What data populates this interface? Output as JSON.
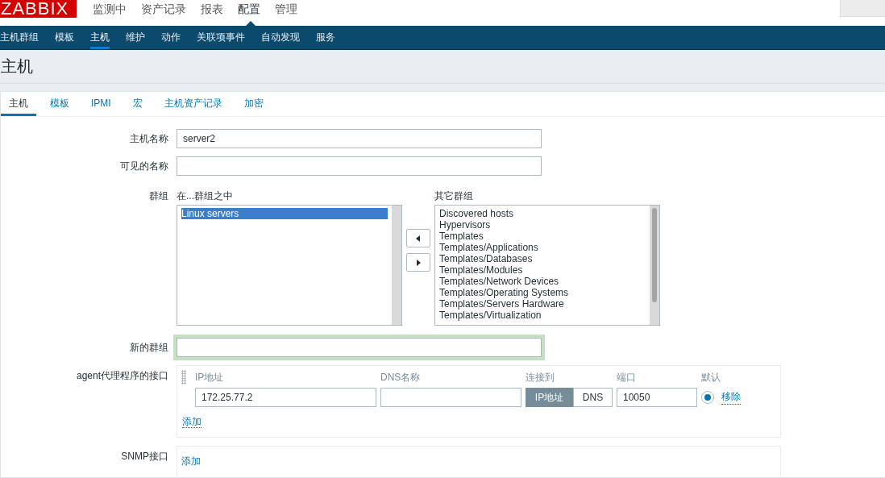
{
  "logo": "ZABBIX",
  "main_menu": [
    {
      "label": "监测中",
      "selected": false
    },
    {
      "label": "资产记录",
      "selected": false
    },
    {
      "label": "报表",
      "selected": false
    },
    {
      "label": "配置",
      "selected": true
    },
    {
      "label": "管理",
      "selected": false
    }
  ],
  "sub_menu": [
    {
      "label": "主机群组",
      "selected": false
    },
    {
      "label": "模板",
      "selected": false
    },
    {
      "label": "主机",
      "selected": true
    },
    {
      "label": "维护",
      "selected": false
    },
    {
      "label": "动作",
      "selected": false
    },
    {
      "label": "关联项事件",
      "selected": false
    },
    {
      "label": "自动发现",
      "selected": false
    },
    {
      "label": "服务",
      "selected": false
    }
  ],
  "page_title": "主机",
  "tabs": [
    {
      "label": "主机",
      "selected": true
    },
    {
      "label": "模板",
      "selected": false
    },
    {
      "label": "IPMI",
      "selected": false
    },
    {
      "label": "宏",
      "selected": false
    },
    {
      "label": "主机资产记录",
      "selected": false
    },
    {
      "label": "加密",
      "selected": false
    }
  ],
  "form": {
    "host_name": {
      "label": "主机名称",
      "value": "server2"
    },
    "visible_name": {
      "label": "可见的名称"
    },
    "groups": {
      "label": "群组",
      "in_groups": {
        "title": "在...群组之中",
        "items": [
          {
            "label": "Linux servers",
            "selected": true
          }
        ]
      },
      "other_groups": {
        "title": "其它群组",
        "items": [
          {
            "label": "Discovered hosts",
            "selected": false
          },
          {
            "label": "Hypervisors",
            "selected": false
          },
          {
            "label": "Templates",
            "selected": false
          },
          {
            "label": "Templates/Applications",
            "selected": false
          },
          {
            "label": "Templates/Databases",
            "selected": false
          },
          {
            "label": "Templates/Modules",
            "selected": false
          },
          {
            "label": "Templates/Network Devices",
            "selected": false
          },
          {
            "label": "Templates/Operating Systems",
            "selected": false
          },
          {
            "label": "Templates/Servers Hardware",
            "selected": false
          },
          {
            "label": "Templates/Virtualization",
            "selected": false
          }
        ]
      }
    },
    "new_group": {
      "label": "新的群组",
      "focused": true
    },
    "agent_interfaces": {
      "label": "agent代理程序的接口",
      "columns": [
        "IP地址",
        "DNS名称",
        "连接到",
        "端口",
        "默认"
      ],
      "rows": [
        {
          "ip": "172.25.77.2",
          "connect_to": [
            {
              "label": "IP地址",
              "selected": true
            },
            {
              "label": "DNS",
              "selected": false
            }
          ],
          "port": "10050",
          "default": true,
          "remove": "移除"
        }
      ],
      "add": "添加"
    },
    "snmp_interfaces": {
      "label": "SNMP接口",
      "add": "添加"
    }
  }
}
